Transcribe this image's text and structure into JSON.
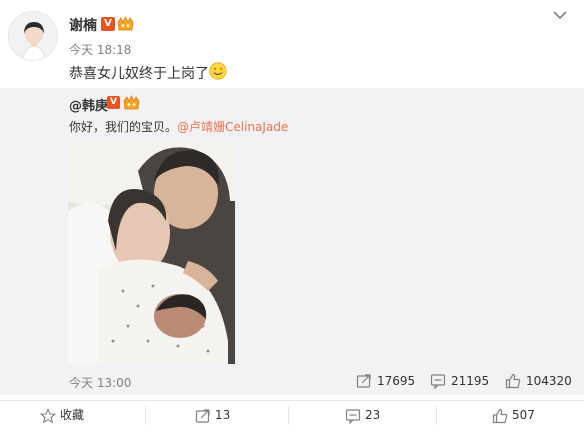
{
  "post": {
    "author": "谢楠",
    "verified_mark": "V",
    "time": "今天 18:18",
    "text": "恭喜女儿奴终于上岗了",
    "emoji": "smile-emoji"
  },
  "repost": {
    "author": "@韩庚",
    "verified_mark": "V",
    "text": "你好，我们的宝贝。",
    "mention": "@卢靖姗CelinaJade",
    "time": "今天 13:00",
    "stats": {
      "repost_count": "17695",
      "comment_count": "21195",
      "like_count": "104320"
    }
  },
  "actions": {
    "favorite": "收藏",
    "repost": "13",
    "comment": "23",
    "like": "507"
  },
  "colors": {
    "link": "#eb7350",
    "verified_badge": "#e8541e",
    "repost_background": "#f2f2f5"
  }
}
